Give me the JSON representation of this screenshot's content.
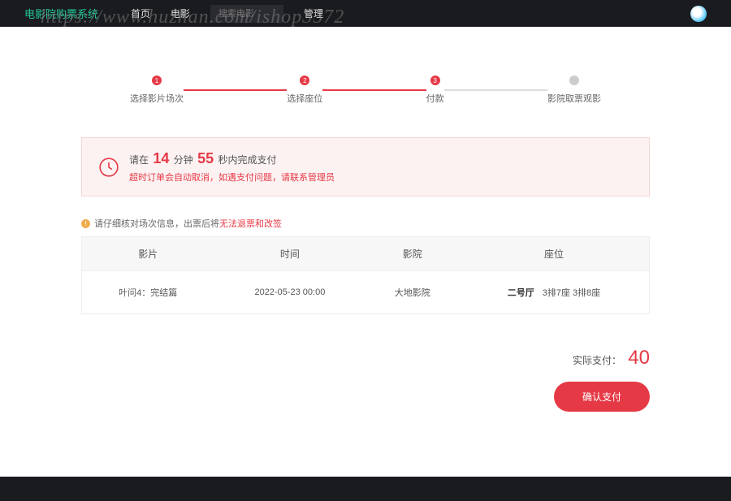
{
  "nav": {
    "brand": "电影院购票系统",
    "home": "首页",
    "movies": "电影",
    "search_placeholder": "搜索电影",
    "admin": "管理"
  },
  "watermark": "https://www.huzhan.com/ishop3572",
  "steps": {
    "s1": "选择影片场次",
    "s2": "选择座位",
    "s3": "付款",
    "s4": "影院取票观影"
  },
  "countdown": {
    "prefix": "请在",
    "min": "14",
    "min_unit": "分钟",
    "sec": "55",
    "sec_unit": "秒内完成支付",
    "sub": "超时订单会自动取消，如遇支付问题，请联系管理员"
  },
  "notice": {
    "text": "请仔细核对场次信息，出票后将",
    "warn": "无法退票和改签"
  },
  "table": {
    "h_movie": "影片",
    "h_time": "时间",
    "h_cinema": "影院",
    "h_seat": "座位",
    "movie": "叶问4：完结篇",
    "time": "2022-05-23 00:00",
    "cinema": "大地影院",
    "hall": "二号厅",
    "seats": "3排7座 3排8座"
  },
  "pay": {
    "label": "实际支付：",
    "amount": "40",
    "confirm": "确认支付"
  }
}
